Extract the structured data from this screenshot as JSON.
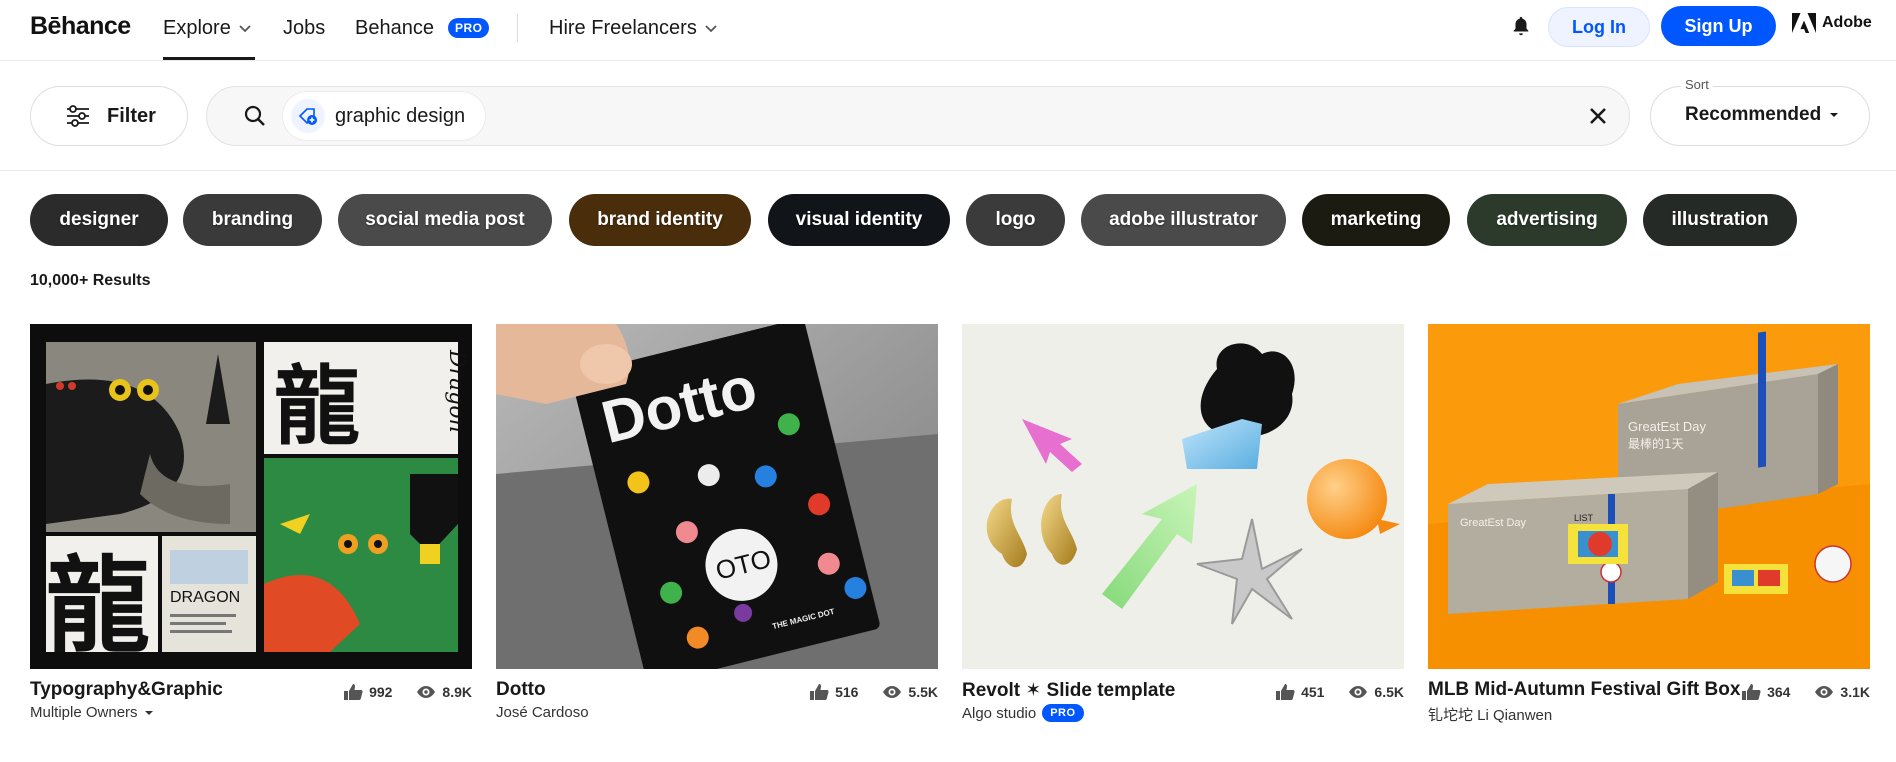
{
  "nav": {
    "logo": "Bēhance",
    "explore": "Explore",
    "jobs": "Jobs",
    "behance": "Behance",
    "pro": "PRO",
    "hire": "Hire Freelancers",
    "login": "Log In",
    "signup": "Sign Up",
    "adobe": "Adobe"
  },
  "search": {
    "filter_label": "Filter",
    "query": "graphic design",
    "sort_label": "Sort",
    "sort_value": "Recommended"
  },
  "tags": [
    {
      "label": "designer",
      "color": "#2b2b2b"
    },
    {
      "label": "branding",
      "color": "#3a3a3a"
    },
    {
      "label": "social media post",
      "color": "#4a4a4a"
    },
    {
      "label": "brand identity",
      "color": "#4a2e0c"
    },
    {
      "label": "visual identity",
      "color": "#111418"
    },
    {
      "label": "logo",
      "color": "#3b3b3b"
    },
    {
      "label": "adobe illustrator",
      "color": "#4a4a4a"
    },
    {
      "label": "marketing",
      "color": "#1b1b12"
    },
    {
      "label": "advertising",
      "color": "#2c3a2c"
    },
    {
      "label": "illustration",
      "color": "#262a26"
    }
  ],
  "results_count": "10,000+ Results",
  "projects": [
    {
      "title": "Typography&Graphic",
      "owner": "Multiple Owners",
      "likes": "992",
      "views": "8.9K"
    },
    {
      "title": "Dotto",
      "owner": "José Cardoso",
      "likes": "516",
      "views": "5.5K"
    },
    {
      "title": "Revolt ✶ Slide template",
      "owner": "Algo studio",
      "owner_badge": "PRO",
      "likes": "451",
      "views": "6.5K"
    },
    {
      "title": "MLB Mid-Autumn Festival Gift Box",
      "owner": "钆坨坨 Li Qianwen",
      "likes": "364",
      "views": "3.1K"
    }
  ],
  "artwork_text": {
    "dragon_char": "龍",
    "dragon_word": "DRAGON",
    "dragon_script": "Dragon",
    "dotto_word": "Dotto",
    "dotto_logo": "OTO",
    "dotto_tagline": "THE MAGIC DOT",
    "box_brand": "GreatEst Day",
    "box_cn": "最棒的1天",
    "box_list": "LIST"
  }
}
